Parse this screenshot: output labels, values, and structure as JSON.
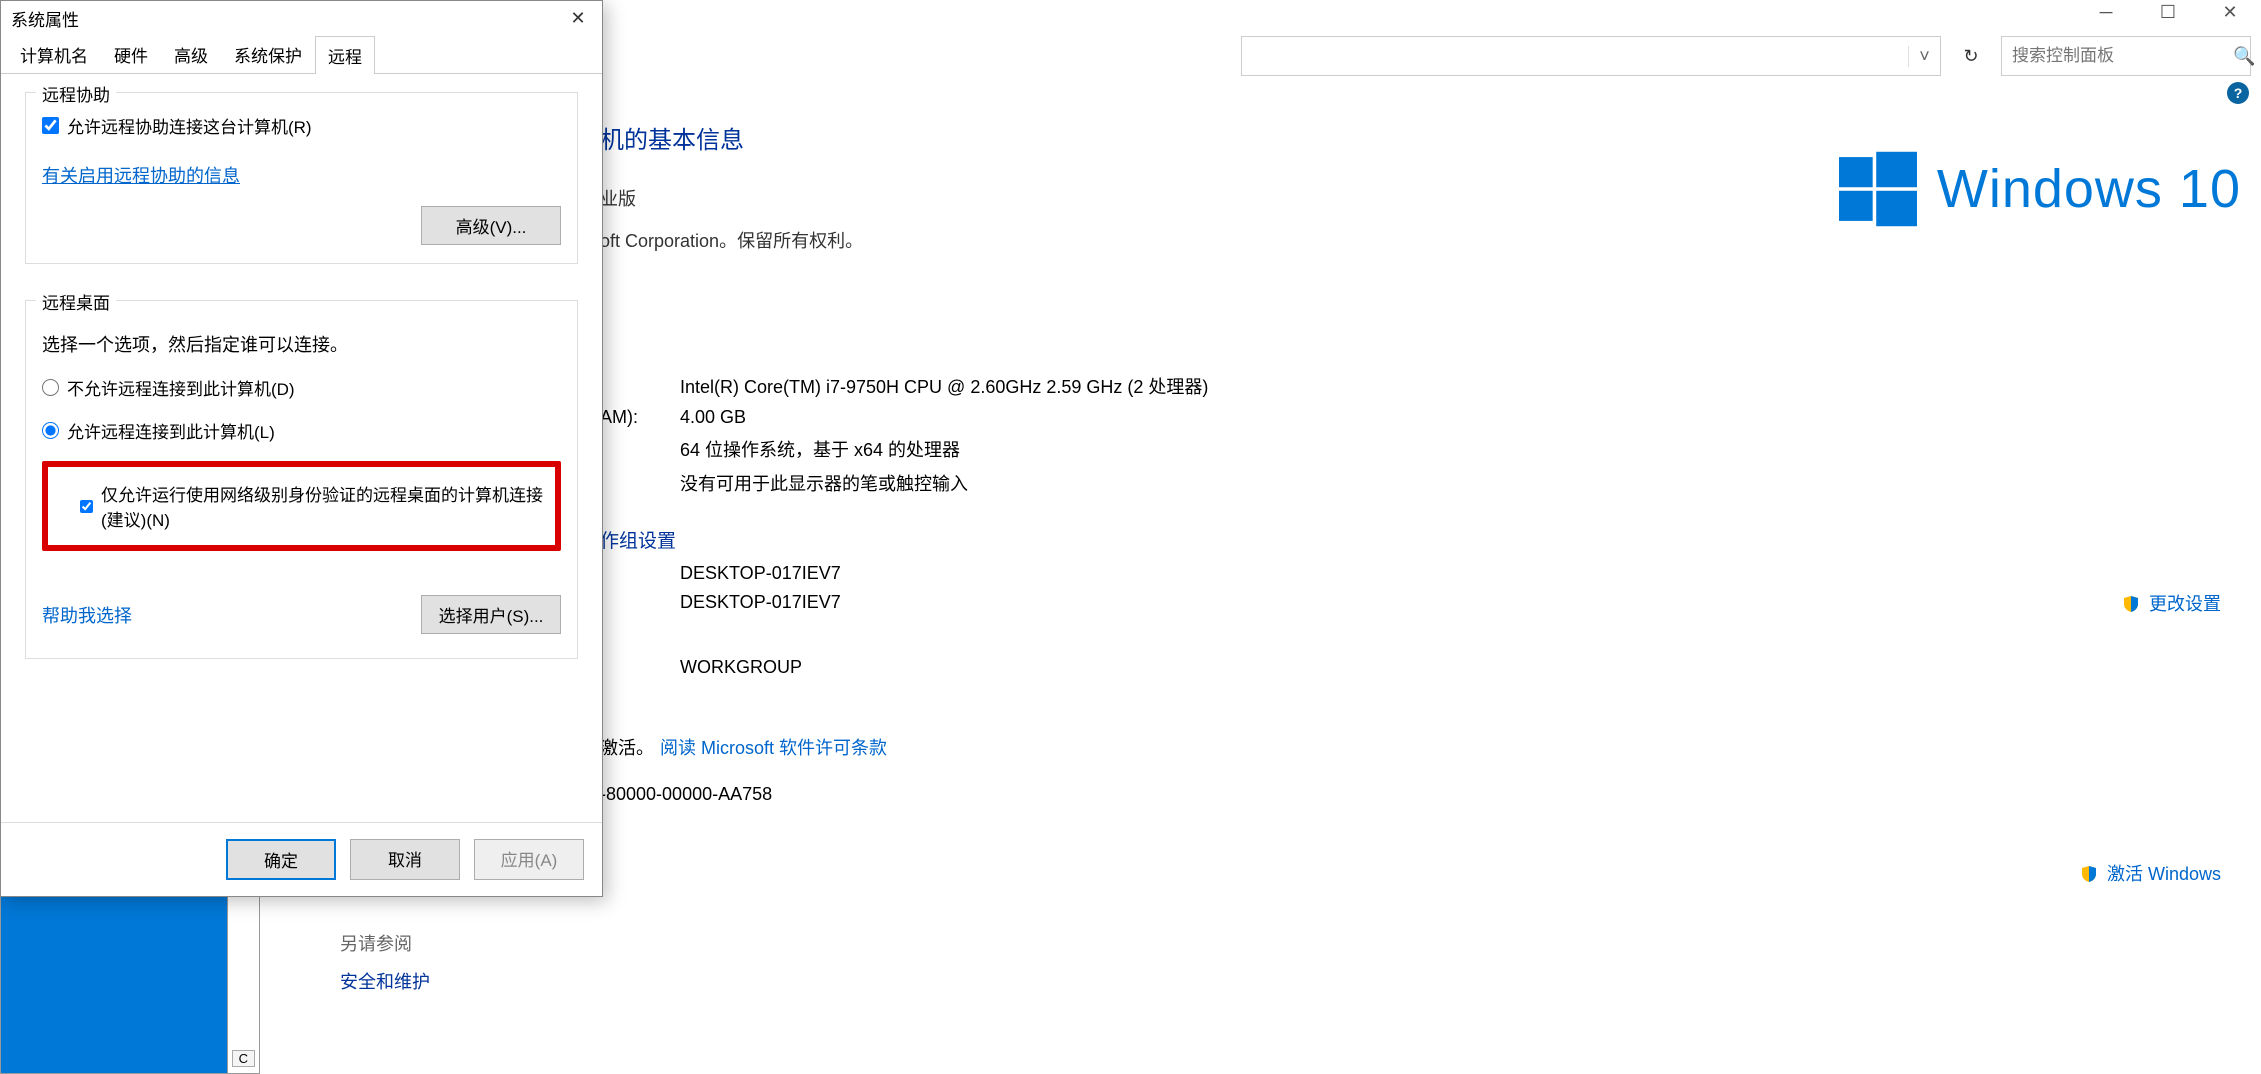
{
  "dialog": {
    "title": "系统属性",
    "tabs": {
      "t1": "计算机名",
      "t2": "硬件",
      "t3": "高级",
      "t4": "系统保护",
      "t5": "远程"
    },
    "remote_assist": {
      "group_title": "远程协助",
      "allow_label": "允许远程协助连接这台计算机(R)",
      "info_link": "有关启用远程协助的信息",
      "advanced_btn": "高级(V)..."
    },
    "remote_desktop": {
      "group_title": "远程桌面",
      "hint": "选择一个选项，然后指定谁可以连接。",
      "opt_disallow": "不允许远程连接到此计算机(D)",
      "opt_allow": "允许远程连接到此计算机(L)",
      "nla_label": "仅允许运行使用网络级别身份验证的远程桌面的计算机连接(建议)(N)",
      "help_link": "帮助我选择",
      "select_users_btn": "选择用户(S)..."
    },
    "buttons": {
      "ok": "确定",
      "cancel": "取消",
      "apply": "应用(A)"
    }
  },
  "control_panel": {
    "search_placeholder": "搜索控制面板",
    "heading_partial": "机的基本信息",
    "edition_partial": "业版",
    "copyright_partial": "oft Corporation。保留所有权利。",
    "win10": "Windows 10",
    "ram_label_partial": "AM):",
    "cpu": "Intel(R) Core(TM) i7-9750H CPU @ 2.60GHz   2.59 GHz  (2 处理器)",
    "ram": "4.00 GB",
    "systype": "64 位操作系统，基于 x64 的处理器",
    "pen": "没有可用于此显示器的笔或触控输入",
    "section_cname_partial": "作组设置",
    "cname": "DESKTOP-017IEV7",
    "fullname": "DESKTOP-017IEV7",
    "workgroup": "WORKGROUP",
    "change_settings": "更改设置",
    "lic_partial1": "激活。  ",
    "lic_link": "阅读 Microsoft 软件许可条款",
    "pid_partial": "-80000-00000-AA758",
    "activate_link": "激活 Windows",
    "see_also": {
      "title": "另请参阅",
      "link1": "安全和维护"
    }
  }
}
